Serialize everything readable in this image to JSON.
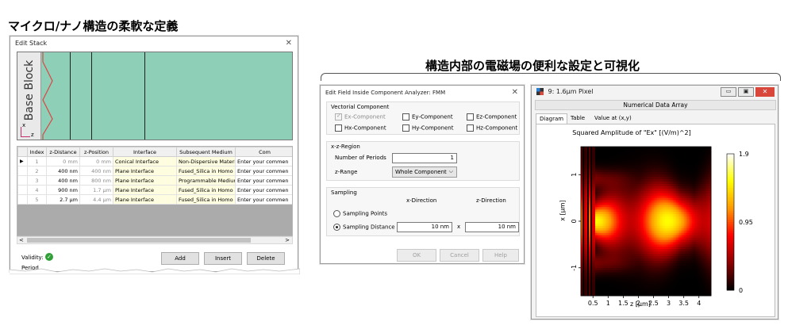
{
  "headings": {
    "left": "マイクロ/ナノ構造の柔軟な定義",
    "right": "構造内部の電磁場の便利な設定と可視化"
  },
  "edit_stack": {
    "title": "Edit Stack",
    "base_block_label": "Base Block",
    "axis_x": "x",
    "axis_z": "z",
    "columns": [
      "Index",
      "z-Distance",
      "z-Position",
      "Interface",
      "Subsequent Medium",
      "Com"
    ],
    "rows": [
      {
        "index": "1",
        "z_distance": "0 mm",
        "z_position": "0 mm",
        "interface": "Conical Interface",
        "medium": "Non-Dispersive Materi",
        "comment": "Enter your commen"
      },
      {
        "index": "2",
        "z_distance": "400 nm",
        "z_position": "400 nm",
        "interface": "Plane Interface",
        "medium": "Fused_Silica in Homo",
        "comment": "Enter your commen"
      },
      {
        "index": "3",
        "z_distance": "400 nm",
        "z_position": "800 nm",
        "interface": "Plane Interface",
        "medium": "Programmable Medium",
        "comment": "Enter your commen"
      },
      {
        "index": "4",
        "z_distance": "900 nm",
        "z_position": "1.7 µm",
        "interface": "Plane Interface",
        "medium": "Fused_Silica in Homo",
        "comment": "Enter your commen"
      },
      {
        "index": "5",
        "z_distance": "2.7 µm",
        "z_position": "4.4 µm",
        "interface": "Plane Interface",
        "medium": "Fused_Silica in Homo",
        "comment": "Enter your commen"
      }
    ],
    "validity_label": "Validity:",
    "buttons": {
      "add": "Add",
      "insert": "Insert",
      "delete": "Delete"
    },
    "period_label": "Period",
    "scroll_left": "<",
    "scroll_right": ">"
  },
  "field_dialog": {
    "title": "Edit Field Inside Component Analyzer: FMM",
    "vectorial_label": "Vectorial Component",
    "components": {
      "ex": "Ex-Component",
      "ey": "Ey-Component",
      "ez": "Ez-Component",
      "hx": "Hx-Component",
      "hy": "Hy-Component",
      "hz": "Hz-Component"
    },
    "xz_region_label": "x-z-Region",
    "periods_label": "Number of Periods",
    "periods_value": "1",
    "zrange_label": "z-Range",
    "zrange_value": "Whole Component",
    "sampling_label": "Sampling",
    "x_direction": "x-Direction",
    "z_direction": "z-Direction",
    "sampling_points": "Sampling Points",
    "sampling_distance": "Sampling Distance",
    "x_value": "10 nm",
    "z_value": "10 nm",
    "times": "x",
    "buttons": {
      "ok": "OK",
      "cancel": "Cancel",
      "help": "Help"
    }
  },
  "data_array_window": {
    "title": "9: 1.6µm Pixel",
    "header": "Numerical Data Array",
    "tabs": [
      "Diagram",
      "Table",
      "Value at (x,y)"
    ],
    "plot_title": "Squared Amplitude of \"Ex\"  [(V/m)^2]"
  },
  "chart_data": {
    "type": "heatmap",
    "title": "Squared Amplitude of \"Ex\"  [(V/m)^2]",
    "xlabel": "z [µm]",
    "ylabel": "x [µm]",
    "x_ticks": [
      "0.5",
      "1",
      "1.5",
      "2",
      "2.5",
      "3",
      "3.5",
      "4"
    ],
    "y_ticks": [
      "1",
      "0",
      "-1"
    ],
    "xlim": [
      0.1,
      4.4
    ],
    "ylim": [
      -1.6,
      1.6
    ],
    "colorbar_ticks": [
      "1.9",
      "0.95",
      "0"
    ],
    "colorbar_range": [
      0,
      1.9
    ],
    "colormap": [
      "#000000",
      "#8b0000",
      "#ff0000",
      "#ff9900",
      "#ffff00",
      "#ffffff"
    ]
  }
}
